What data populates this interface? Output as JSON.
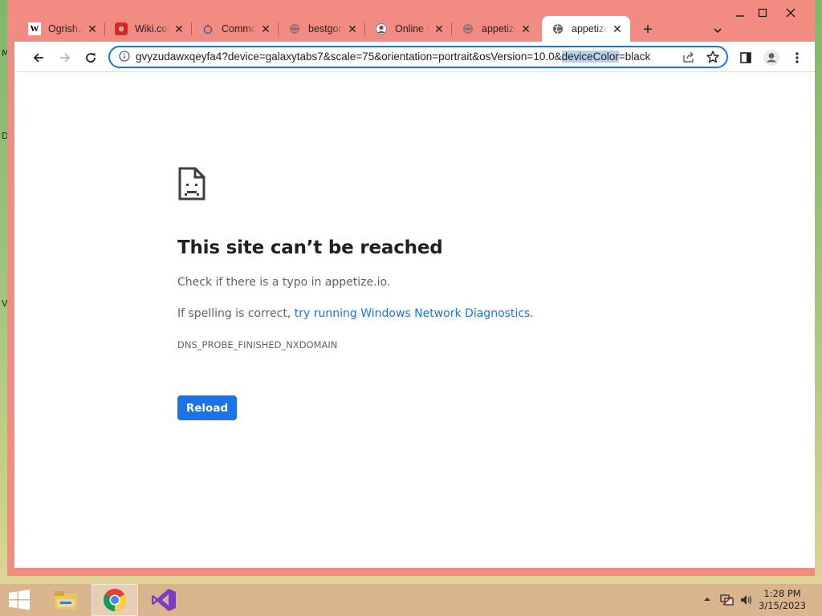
{
  "desktop": {
    "side_letters": [
      "M",
      "D",
      "V"
    ]
  },
  "tabs": [
    {
      "title": "Ogrish.com",
      "favicon": "W",
      "active": false
    },
    {
      "title": "Wiki.com",
      "favicon": "e",
      "active": false
    },
    {
      "title": "Commons",
      "favicon": "commons-icon",
      "active": false
    },
    {
      "title": "bestgore",
      "favicon": "globe-icon",
      "active": false
    },
    {
      "title": "Online C",
      "favicon": "avatar-icon",
      "active": false
    },
    {
      "title": "appetize",
      "favicon": "globe-icon",
      "active": false
    },
    {
      "title": "appetize",
      "favicon": "globe-icon",
      "active": true
    }
  ],
  "new_tab_label": "+",
  "address_bar": {
    "url_before": "gvyzudawxqeyfa4?device=galaxytabs7&scale=75&orientation=portrait&osVersion=10.0&",
    "url_highlight": "deviceColor",
    "url_after": "=black"
  },
  "error_page": {
    "title": "This site can’t be reached",
    "line1": "Check if there is a typo in appetize.io.",
    "line2_prefix": "If spelling is correct, ",
    "line2_link": "try running Windows Network Diagnostics",
    "line2_suffix": ".",
    "error_code": "DNS_PROBE_FINISHED_NXDOMAIN",
    "reload_label": "Reload"
  },
  "taskbar": {
    "time": "1:28 PM",
    "date": "3/15/2023"
  },
  "colors": {
    "window_frame": "#f28b82",
    "accent": "#1a73e8"
  }
}
